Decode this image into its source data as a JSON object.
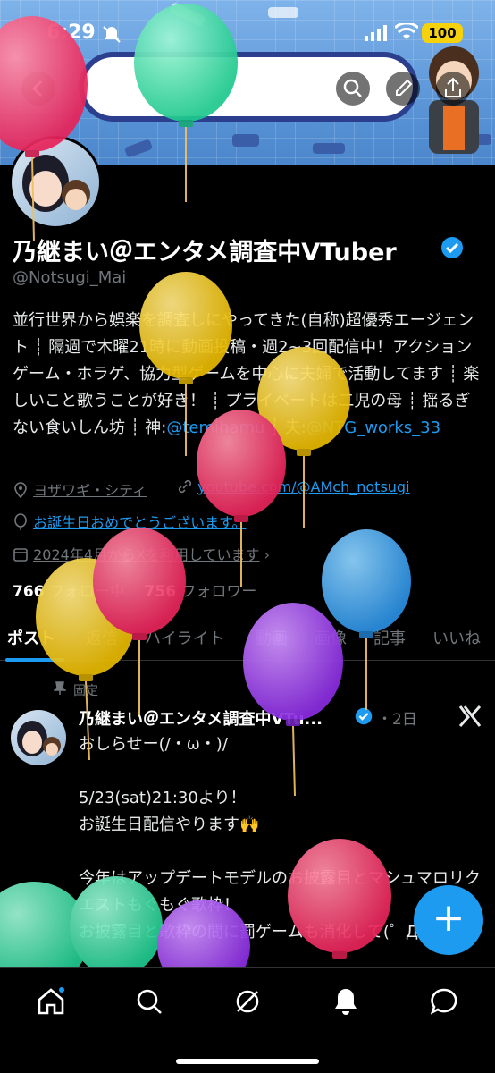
{
  "status_bar": {
    "time": "6:29",
    "battery": "100"
  },
  "profile": {
    "name": "乃継まい＠エンタメ調査中VTuber",
    "handle": "@Notsugi_Mai",
    "bio_text": "並行世界から娯楽を調査しにやってきた(自称)超優秀エージェント ┊ 隔週で木曜21時に動画投稿・週2~3回配信中！アクションゲーム・ホラゲ、協力型ゲームを中心に夫婦で活動してます ┊ 楽しいこと歌うことが好き！ ┊ プライベートは二児の母 ┊ 揺るぎない食いしん坊 ┊ ",
    "bio_god_label": "神:",
    "bio_god_link": "@temihamu",
    "bio_sep": " ┊ 夫:",
    "bio_husband_link": "@NTG_works_33",
    "location": "ヨザワギ・シティ",
    "website": "youtube.com/@AMch_notsugi",
    "birthday": "お誕生日おめでとうございます。",
    "joined": "2024年4月からXを利用しています",
    "following_count": "766",
    "following_label": "フォロー中",
    "followers_count": "756",
    "followers_label": "フォロワー"
  },
  "tabs": [
    "ポスト",
    "返信",
    "ハイライト",
    "動画",
    "画像",
    "記事",
    "いいね"
  ],
  "post": {
    "pinned_label": "固定",
    "author": "乃継まい＠エンタメ調査中VTu...",
    "time": "・2日",
    "text": "おしらせー(/・ω・)/\n\n5/23(sat)21:30より！\nお誕生日配信やります🙌\n\n今年はアップデートモデルのお披露目とマシュマロリクエストもぐもぐ歌枠！\nお披露目と歌枠の間に罰ゲームも消化して(゜Д゜)"
  },
  "fab_label": "+",
  "colors": {
    "accent": "#1d9bf0",
    "background": "#000000"
  },
  "icons": [
    "back-icon",
    "search-icon",
    "edit-icon",
    "share-icon",
    "location-icon",
    "link-icon",
    "balloon-icon",
    "calendar-icon",
    "pin-icon",
    "x-logo-icon",
    "home-icon",
    "grok-icon",
    "bell-icon",
    "chat-icon"
  ]
}
